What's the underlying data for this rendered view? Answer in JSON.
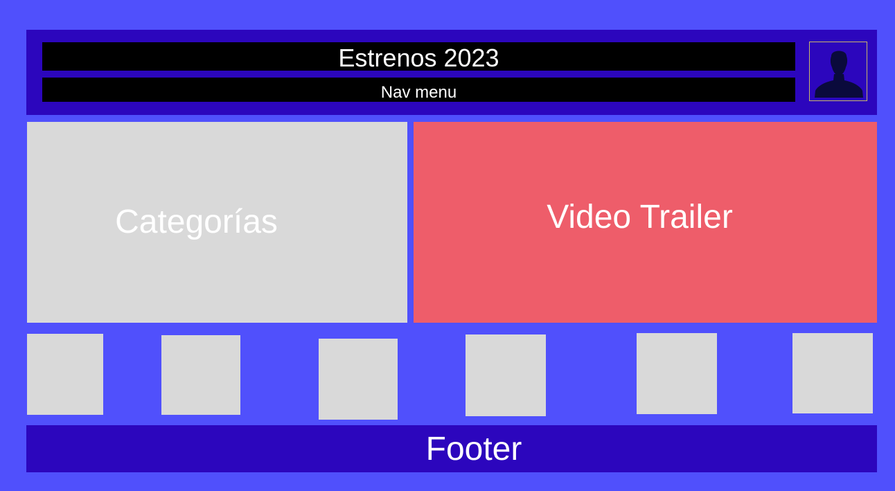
{
  "header": {
    "title": "Estrenos 2023",
    "nav_label": "Nav menu",
    "avatar_icon": "user-silhouette-icon"
  },
  "main": {
    "categories_label": "Categorías",
    "trailer_label": "Video Trailer"
  },
  "thumbnails": [
    "",
    "",
    "",
    "",
    "",
    ""
  ],
  "footer": {
    "label": "Footer"
  },
  "colors": {
    "background": "#5050fc",
    "header": "#2c06bd",
    "bar": "#000000",
    "placeholder": "#d9d9d9",
    "trailer": "#ee5d6a"
  }
}
